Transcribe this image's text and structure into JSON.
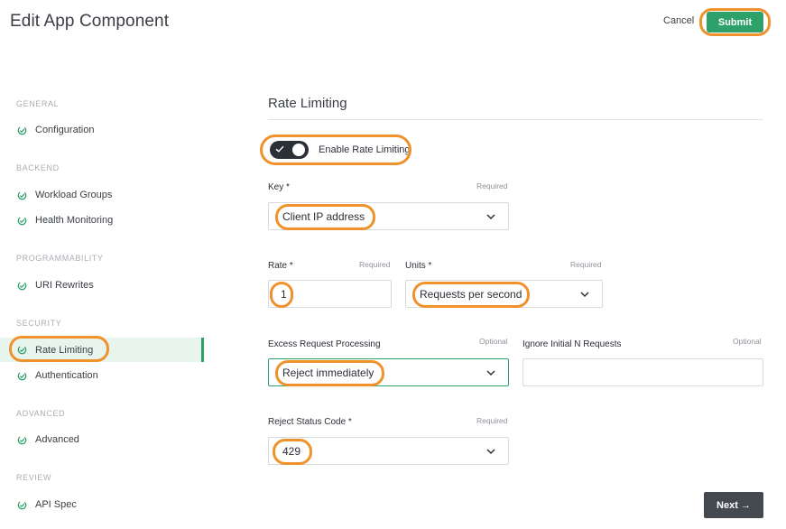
{
  "header": {
    "title": "Edit App Component",
    "cancel_label": "Cancel",
    "submit_label": "Submit"
  },
  "sidebar": {
    "sections": [
      {
        "title": "GENERAL",
        "items": [
          {
            "label": "Configuration",
            "icon": "check-circle-icon"
          }
        ]
      },
      {
        "title": "BACKEND",
        "items": [
          {
            "label": "Workload Groups",
            "icon": "check-circle-icon"
          },
          {
            "label": "Health Monitoring",
            "icon": "check-circle-icon"
          }
        ]
      },
      {
        "title": "PROGRAMMABILITY",
        "items": [
          {
            "label": "URI Rewrites",
            "icon": "check-circle-icon"
          }
        ]
      },
      {
        "title": "SECURITY",
        "items": [
          {
            "label": "Rate Limiting",
            "icon": "check-circle-icon",
            "active": true
          },
          {
            "label": "Authentication",
            "icon": "check-circle-icon"
          }
        ]
      },
      {
        "title": "ADVANCED",
        "items": [
          {
            "label": "Advanced",
            "icon": "check-circle-icon"
          }
        ]
      },
      {
        "title": "REVIEW",
        "items": [
          {
            "label": "API Spec",
            "icon": "check-circle-icon"
          }
        ]
      }
    ]
  },
  "form": {
    "section_title": "Rate Limiting",
    "toggle": {
      "label": "Enable Rate Limiting",
      "enabled": true
    },
    "key": {
      "label": "Key *",
      "required": "Required",
      "value": "Client IP address"
    },
    "rate": {
      "label": "Rate *",
      "required": "Required",
      "value": "1"
    },
    "units": {
      "label": "Units *",
      "required": "Required",
      "value": "Requests per second"
    },
    "excess": {
      "label": "Excess Request Processing",
      "optional": "Optional",
      "value": "Reject immediately"
    },
    "ignore": {
      "label": "Ignore Initial N Requests",
      "optional": "Optional",
      "value": ""
    },
    "status": {
      "label": "Reject Status Code *",
      "required": "Required",
      "value": "429"
    },
    "next_label": "Next →"
  },
  "colors": {
    "accent": "#2ea06a",
    "highlight": "#f0922b",
    "dark": "#2b2f36"
  }
}
